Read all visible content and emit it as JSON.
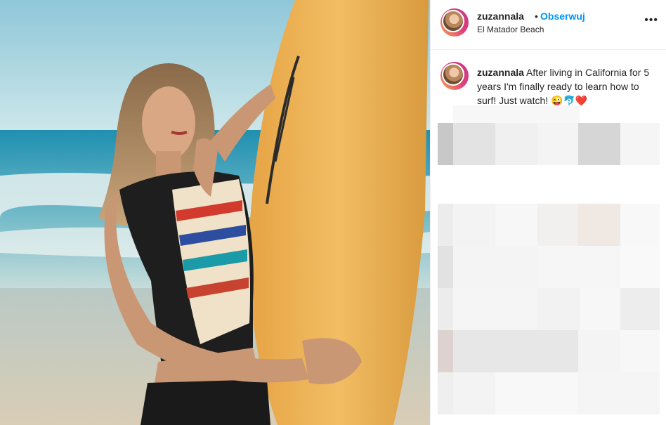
{
  "post": {
    "username": "zuzannala",
    "separator": "•",
    "follow_label": "Obserwuj",
    "location": "El Matador Beach",
    "more_label": "•••",
    "caption_username": "zuzannala",
    "caption_text": " After living in California for 5 years I'm finally ready to learn how to surf! Just watch! 😜🐬❤️"
  },
  "colors": {
    "accent": "#0095f6",
    "text": "#262626",
    "border": "#efefef"
  },
  "icons": {
    "more": "more-options-icon",
    "avatar": "profile-avatar"
  }
}
